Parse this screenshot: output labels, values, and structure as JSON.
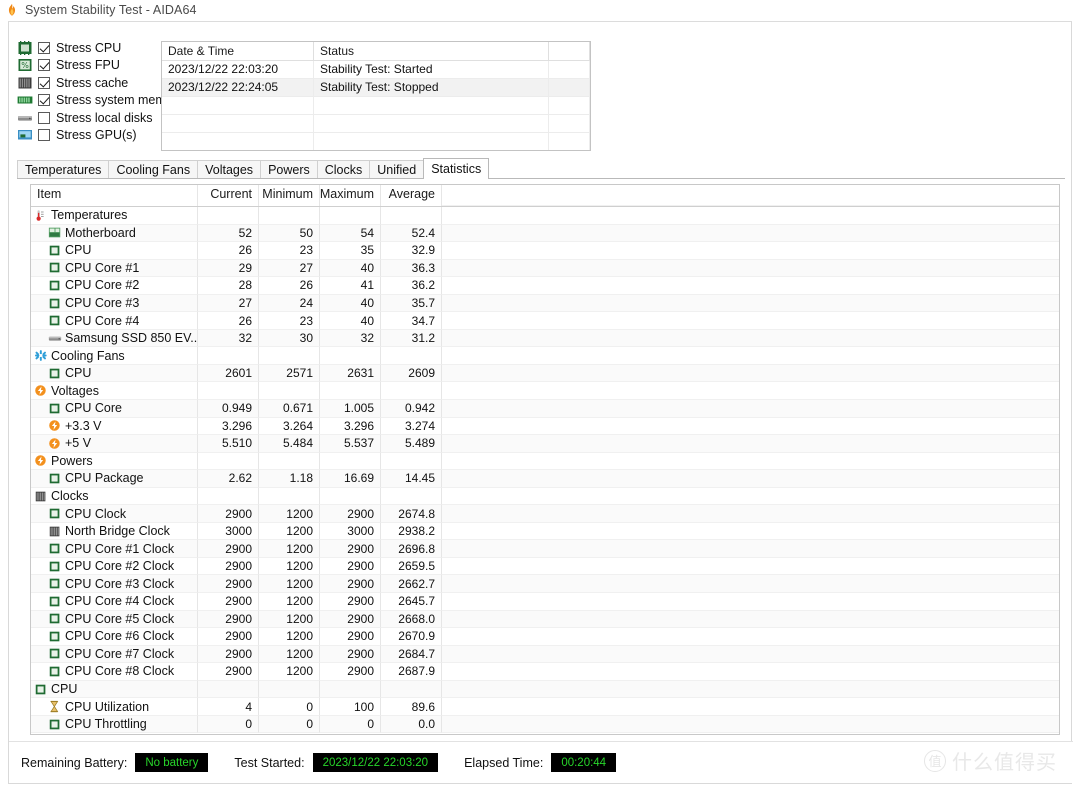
{
  "window": {
    "title": "System Stability Test - AIDA64",
    "title_icon": "flame-icon"
  },
  "stress_options": [
    {
      "label": "Stress CPU",
      "checked": true,
      "icon": "cpu-chip-icon"
    },
    {
      "label": "Stress FPU",
      "checked": true,
      "icon": "fpu-percent-icon"
    },
    {
      "label": "Stress cache",
      "checked": true,
      "icon": "cache-module-icon"
    },
    {
      "label": "Stress system memory",
      "checked": true,
      "icon": "memory-module-icon"
    },
    {
      "label": "Stress local disks",
      "checked": false,
      "icon": "disk-drive-icon"
    },
    {
      "label": "Stress GPU(s)",
      "checked": false,
      "icon": "gpu-monitor-icon"
    }
  ],
  "log": {
    "headers": [
      "Date & Time",
      "Status",
      ""
    ],
    "rows": [
      {
        "datetime": "2023/12/22 22:03:20",
        "status": "Stability Test: Started"
      },
      {
        "datetime": "2023/12/22 22:24:05",
        "status": "Stability Test: Stopped"
      }
    ],
    "empty_rows": 3
  },
  "tabs": [
    {
      "label": "Temperatures",
      "active": false
    },
    {
      "label": "Cooling Fans",
      "active": false
    },
    {
      "label": "Voltages",
      "active": false
    },
    {
      "label": "Powers",
      "active": false
    },
    {
      "label": "Clocks",
      "active": false
    },
    {
      "label": "Unified",
      "active": false
    },
    {
      "label": "Statistics",
      "active": true
    }
  ],
  "statistics": {
    "headers": [
      "Item",
      "Current",
      "Minimum",
      "Maximum",
      "Average"
    ],
    "rows": [
      {
        "label": "Temperatures",
        "icon": "thermometer-icon",
        "group": true,
        "indent": 0,
        "current": "",
        "minimum": "",
        "maximum": "",
        "average": ""
      },
      {
        "label": "Motherboard",
        "icon": "motherboard-icon",
        "group": false,
        "indent": 1,
        "current": "52",
        "minimum": "50",
        "maximum": "54",
        "average": "52.4"
      },
      {
        "label": "CPU",
        "icon": "cpu-chip-icon",
        "group": false,
        "indent": 1,
        "current": "26",
        "minimum": "23",
        "maximum": "35",
        "average": "32.9"
      },
      {
        "label": "CPU Core #1",
        "icon": "cpu-chip-icon",
        "group": false,
        "indent": 1,
        "current": "29",
        "minimum": "27",
        "maximum": "40",
        "average": "36.3"
      },
      {
        "label": "CPU Core #2",
        "icon": "cpu-chip-icon",
        "group": false,
        "indent": 1,
        "current": "28",
        "minimum": "26",
        "maximum": "41",
        "average": "36.2"
      },
      {
        "label": "CPU Core #3",
        "icon": "cpu-chip-icon",
        "group": false,
        "indent": 1,
        "current": "27",
        "minimum": "24",
        "maximum": "40",
        "average": "35.7"
      },
      {
        "label": "CPU Core #4",
        "icon": "cpu-chip-icon",
        "group": false,
        "indent": 1,
        "current": "26",
        "minimum": "23",
        "maximum": "40",
        "average": "34.7"
      },
      {
        "label": "Samsung SSD 850 EV...",
        "icon": "disk-drive-icon",
        "group": false,
        "indent": 1,
        "current": "32",
        "minimum": "30",
        "maximum": "32",
        "average": "31.2"
      },
      {
        "label": "Cooling Fans",
        "icon": "fan-icon",
        "group": true,
        "indent": 0,
        "current": "",
        "minimum": "",
        "maximum": "",
        "average": ""
      },
      {
        "label": "CPU",
        "icon": "cpu-chip-icon",
        "group": false,
        "indent": 1,
        "current": "2601",
        "minimum": "2571",
        "maximum": "2631",
        "average": "2609"
      },
      {
        "label": "Voltages",
        "icon": "bolt-icon",
        "group": true,
        "indent": 0,
        "current": "",
        "minimum": "",
        "maximum": "",
        "average": ""
      },
      {
        "label": "CPU Core",
        "icon": "cpu-chip-icon",
        "group": false,
        "indent": 1,
        "current": "0.949",
        "minimum": "0.671",
        "maximum": "1.005",
        "average": "0.942"
      },
      {
        "label": "+3.3 V",
        "icon": "bolt-icon",
        "group": false,
        "indent": 1,
        "current": "3.296",
        "minimum": "3.264",
        "maximum": "3.296",
        "average": "3.274"
      },
      {
        "label": "+5 V",
        "icon": "bolt-icon",
        "group": false,
        "indent": 1,
        "current": "5.510",
        "minimum": "5.484",
        "maximum": "5.537",
        "average": "5.489"
      },
      {
        "label": "Powers",
        "icon": "bolt-icon",
        "group": true,
        "indent": 0,
        "current": "",
        "minimum": "",
        "maximum": "",
        "average": ""
      },
      {
        "label": "CPU Package",
        "icon": "cpu-chip-icon",
        "group": false,
        "indent": 1,
        "current": "2.62",
        "minimum": "1.18",
        "maximum": "16.69",
        "average": "14.45"
      },
      {
        "label": "Clocks",
        "icon": "cache-module-icon",
        "group": true,
        "indent": 0,
        "current": "",
        "minimum": "",
        "maximum": "",
        "average": ""
      },
      {
        "label": "CPU Clock",
        "icon": "cpu-chip-icon",
        "group": false,
        "indent": 1,
        "current": "2900",
        "minimum": "1200",
        "maximum": "2900",
        "average": "2674.8"
      },
      {
        "label": "North Bridge Clock",
        "icon": "cache-module-icon",
        "group": false,
        "indent": 1,
        "current": "3000",
        "minimum": "1200",
        "maximum": "3000",
        "average": "2938.2"
      },
      {
        "label": "CPU Core #1 Clock",
        "icon": "cpu-chip-icon",
        "group": false,
        "indent": 1,
        "current": "2900",
        "minimum": "1200",
        "maximum": "2900",
        "average": "2696.8"
      },
      {
        "label": "CPU Core #2 Clock",
        "icon": "cpu-chip-icon",
        "group": false,
        "indent": 1,
        "current": "2900",
        "minimum": "1200",
        "maximum": "2900",
        "average": "2659.5"
      },
      {
        "label": "CPU Core #3 Clock",
        "icon": "cpu-chip-icon",
        "group": false,
        "indent": 1,
        "current": "2900",
        "minimum": "1200",
        "maximum": "2900",
        "average": "2662.7"
      },
      {
        "label": "CPU Core #4 Clock",
        "icon": "cpu-chip-icon",
        "group": false,
        "indent": 1,
        "current": "2900",
        "minimum": "1200",
        "maximum": "2900",
        "average": "2645.7"
      },
      {
        "label": "CPU Core #5 Clock",
        "icon": "cpu-chip-icon",
        "group": false,
        "indent": 1,
        "current": "2900",
        "minimum": "1200",
        "maximum": "2900",
        "average": "2668.0"
      },
      {
        "label": "CPU Core #6 Clock",
        "icon": "cpu-chip-icon",
        "group": false,
        "indent": 1,
        "current": "2900",
        "minimum": "1200",
        "maximum": "2900",
        "average": "2670.9"
      },
      {
        "label": "CPU Core #7 Clock",
        "icon": "cpu-chip-icon",
        "group": false,
        "indent": 1,
        "current": "2900",
        "minimum": "1200",
        "maximum": "2900",
        "average": "2684.7"
      },
      {
        "label": "CPU Core #8 Clock",
        "icon": "cpu-chip-icon",
        "group": false,
        "indent": 1,
        "current": "2900",
        "minimum": "1200",
        "maximum": "2900",
        "average": "2687.9"
      },
      {
        "label": "CPU",
        "icon": "cpu-chip-icon",
        "group": true,
        "indent": 0,
        "current": "",
        "minimum": "",
        "maximum": "",
        "average": ""
      },
      {
        "label": "CPU Utilization",
        "icon": "hourglass-icon",
        "group": false,
        "indent": 1,
        "current": "4",
        "minimum": "0",
        "maximum": "100",
        "average": "89.6"
      },
      {
        "label": "CPU Throttling",
        "icon": "cpu-chip-icon",
        "group": false,
        "indent": 1,
        "current": "0",
        "minimum": "0",
        "maximum": "0",
        "average": "0.0"
      }
    ]
  },
  "statusbar": {
    "battery_label": "Remaining Battery:",
    "battery_value": "No battery",
    "started_label": "Test Started:",
    "started_value": "2023/12/22 22:03:20",
    "elapsed_label": "Elapsed Time:",
    "elapsed_value": "00:20:44",
    "badge_bg": "#000000",
    "badge_fg": "#27d52a"
  },
  "watermark": {
    "mark": "值",
    "text": "什么值得买"
  }
}
